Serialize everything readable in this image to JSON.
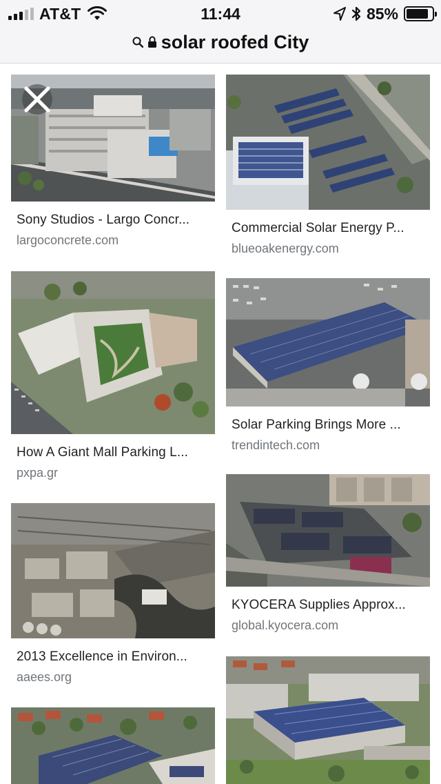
{
  "status_bar": {
    "carrier": "AT&T",
    "time": "11:44",
    "battery_percent": "85%",
    "battery_level": 0.85,
    "signal_bars_active": 3,
    "signal_bars_total": 5
  },
  "url_bar": {
    "query": "solar roofed City",
    "icons": [
      "search-icon",
      "lock-icon"
    ]
  },
  "close_control": {
    "icon": "close-icon"
  },
  "results": [
    {
      "title": "Sony Studios - Largo Concr...",
      "source": "largoconcrete.com",
      "image": "aerial office buildings with rooftop pool"
    },
    {
      "title": "Commercial Solar Energy P...",
      "source": "blueoakenergy.com",
      "image": "aerial rooftop and carport solar panels"
    },
    {
      "title": "How A Giant Mall Parking L...",
      "source": "pxpa.gr",
      "image": "aerial apartment complex with green courtyard"
    },
    {
      "title": "Solar Parking Brings More ...",
      "source": "trendintech.com",
      "image": "solar canopy over parking garage"
    },
    {
      "title": "2013 Excellence in Environ...",
      "source": "aaees.org",
      "image": "aerial industrial waterfront"
    },
    {
      "title": "KYOCERA Supplies Approx...",
      "source": "global.kyocera.com",
      "image": "aerial mall with solar roofs"
    },
    {
      "title": "",
      "source": "",
      "image": "aerial neighborhood with solar roofs"
    },
    {
      "title": "",
      "source": "",
      "image": "aerial campus with solar parking structure"
    }
  ],
  "colors": {
    "header_bg": "#f5f5f7",
    "title_text": "#222222",
    "source_text": "#70757a",
    "solar_blue": "#3b4f86"
  }
}
